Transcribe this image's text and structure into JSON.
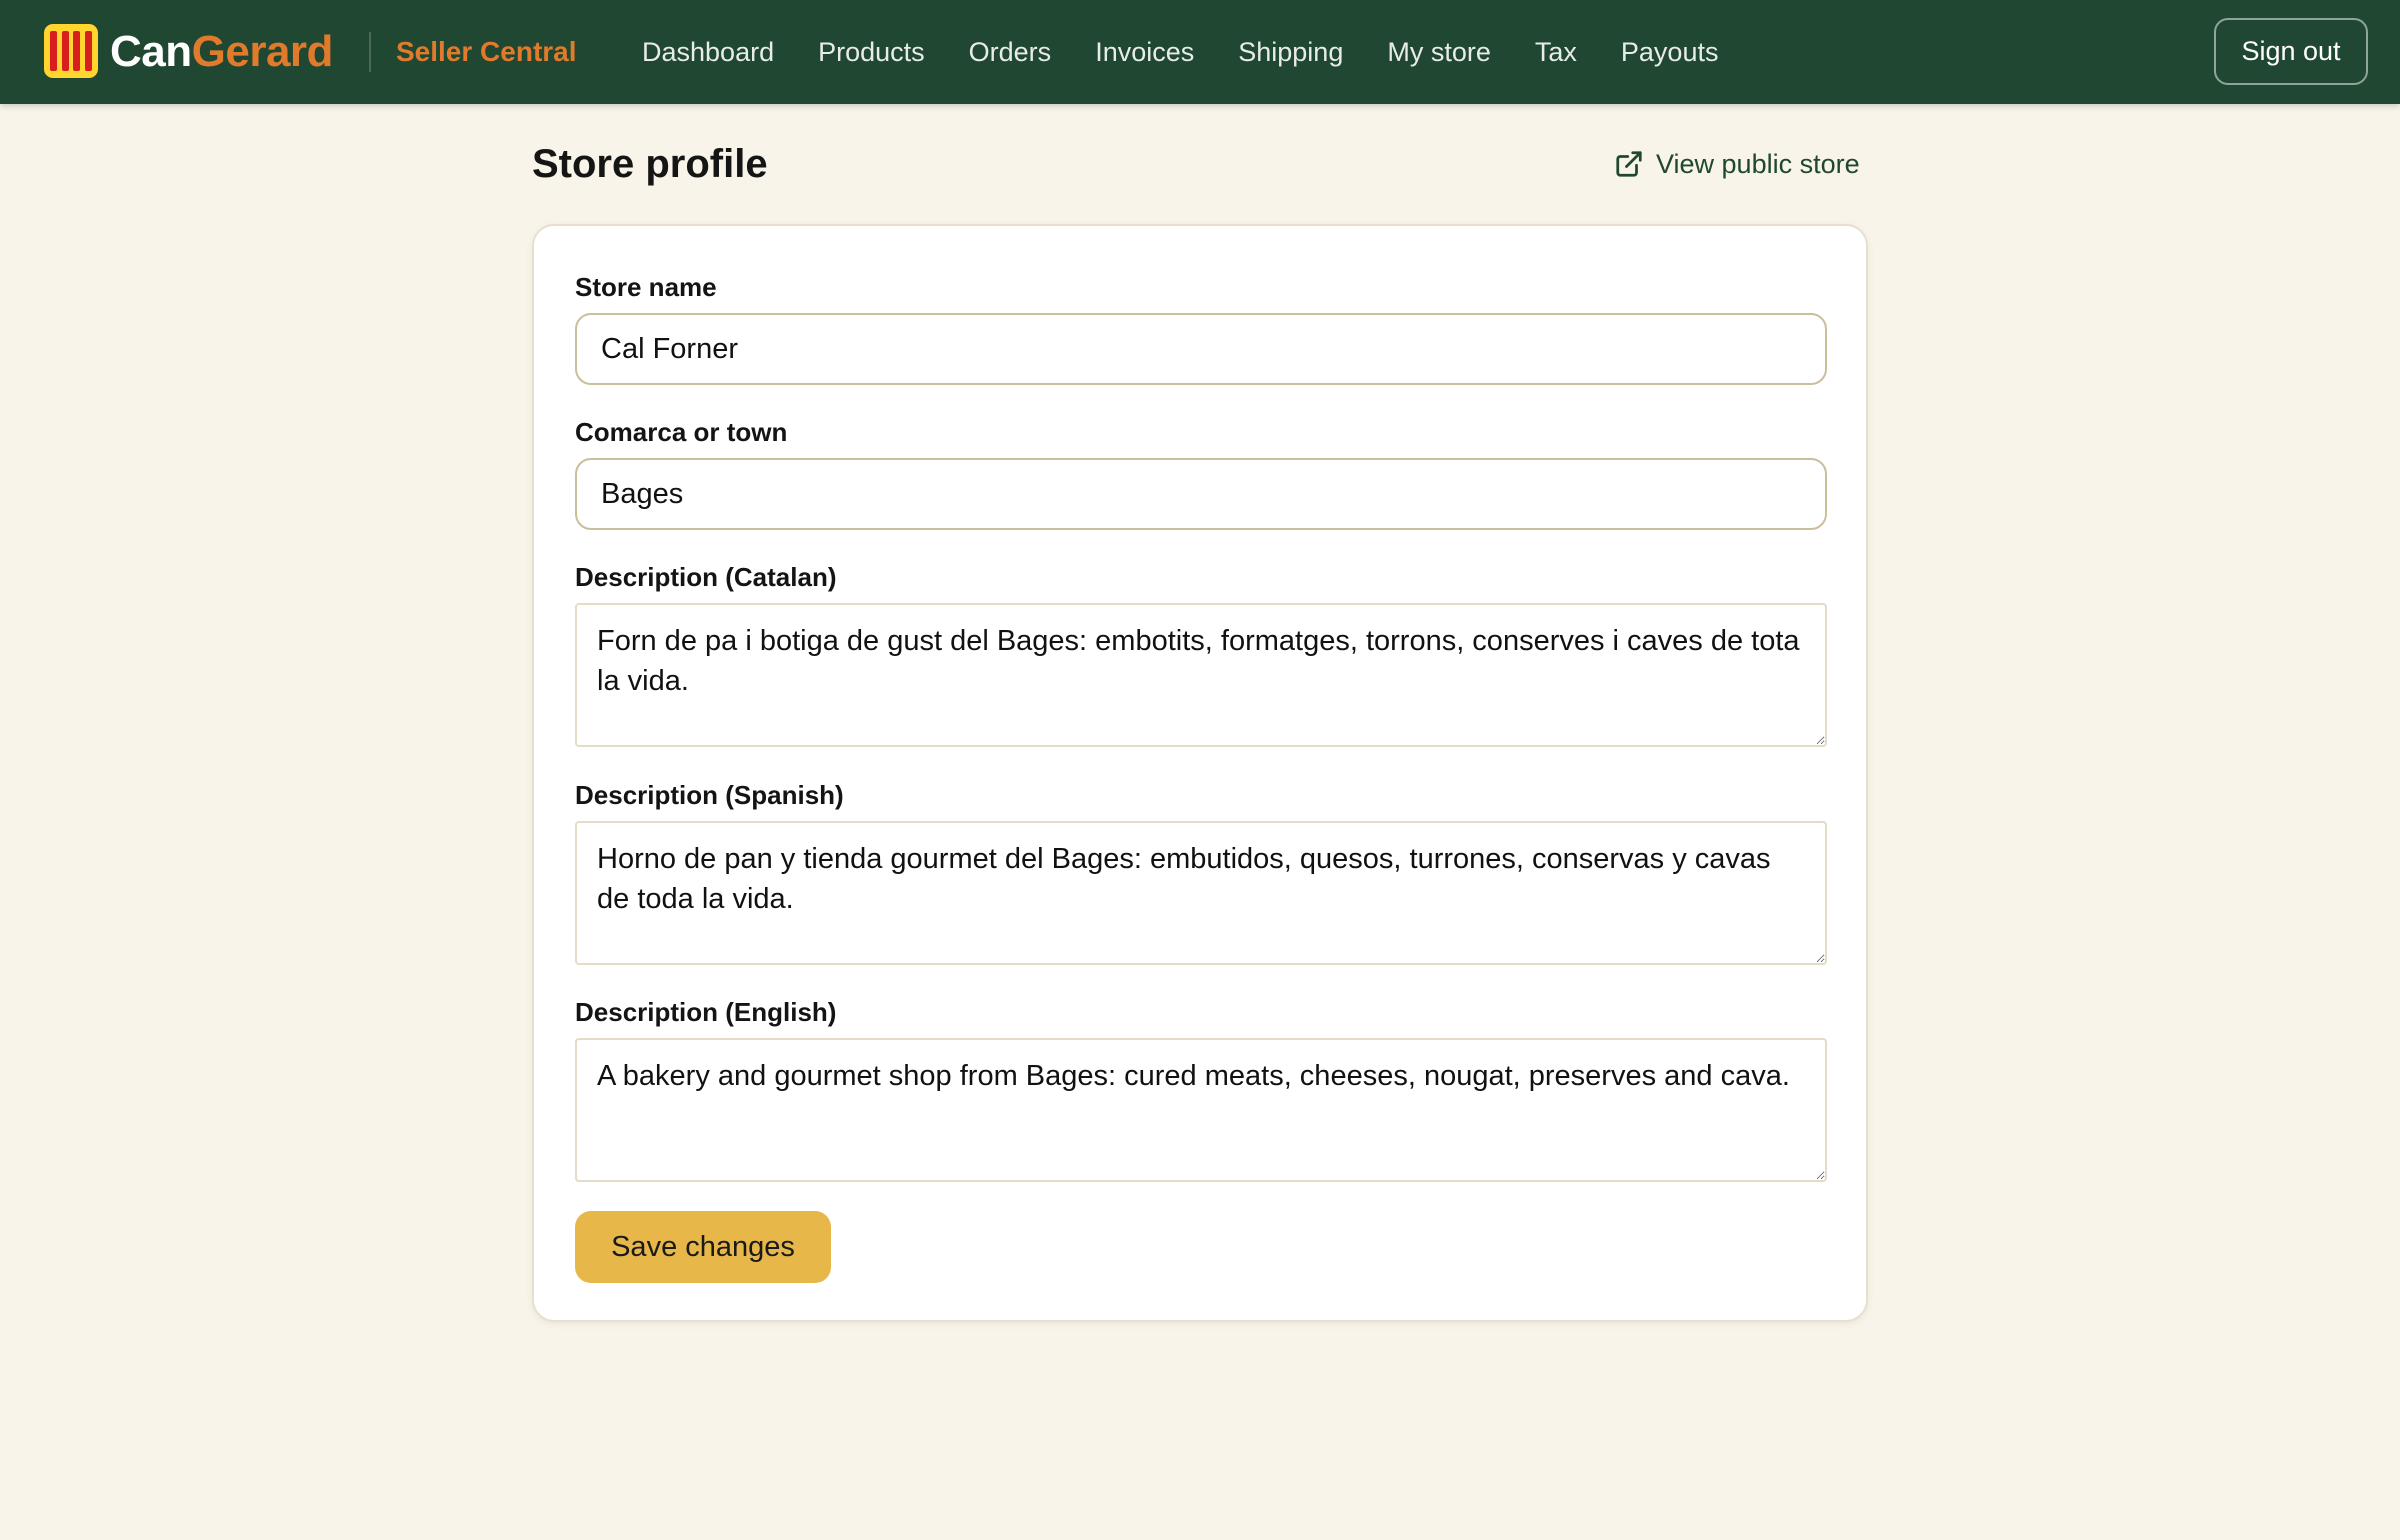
{
  "brand": {
    "name_part1": "Can",
    "name_part2": "Gerard",
    "subtitle": "Seller Central"
  },
  "colors": {
    "topbar": "#1f4731",
    "brand_accent": "#e07a2c",
    "button": "#e8b74a",
    "background": "#f8f4e9",
    "logo_yellow": "#ffd52e",
    "logo_red": "#d81e1e"
  },
  "nav": {
    "items": [
      {
        "label": "Dashboard"
      },
      {
        "label": "Products"
      },
      {
        "label": "Orders"
      },
      {
        "label": "Invoices"
      },
      {
        "label": "Shipping"
      },
      {
        "label": "My store"
      },
      {
        "label": "Tax"
      },
      {
        "label": "Payouts"
      }
    ],
    "sign_out": "Sign out"
  },
  "page": {
    "title": "Store profile",
    "public_link": "View public store",
    "public_link_icon": "external-link-icon"
  },
  "form": {
    "store_name": {
      "label": "Store name",
      "value": "Cal Forner"
    },
    "comarca": {
      "label": "Comarca or town",
      "value": "Bages"
    },
    "desc_ca": {
      "label": "Description (Catalan)",
      "value": "Forn de pa i botiga de gust del Bages: embotits, formatges, torrons, conserves i caves de tota la vida."
    },
    "desc_es": {
      "label": "Description (Spanish)",
      "value": "Horno de pan y tienda gourmet del Bages: embutidos, quesos, turrones, conservas y cavas de toda la vida."
    },
    "desc_en": {
      "label": "Description (English)",
      "value": "A bakery and gourmet shop from Bages: cured meats, cheeses, nougat, preserves and cava."
    },
    "save_label": "Save changes"
  }
}
